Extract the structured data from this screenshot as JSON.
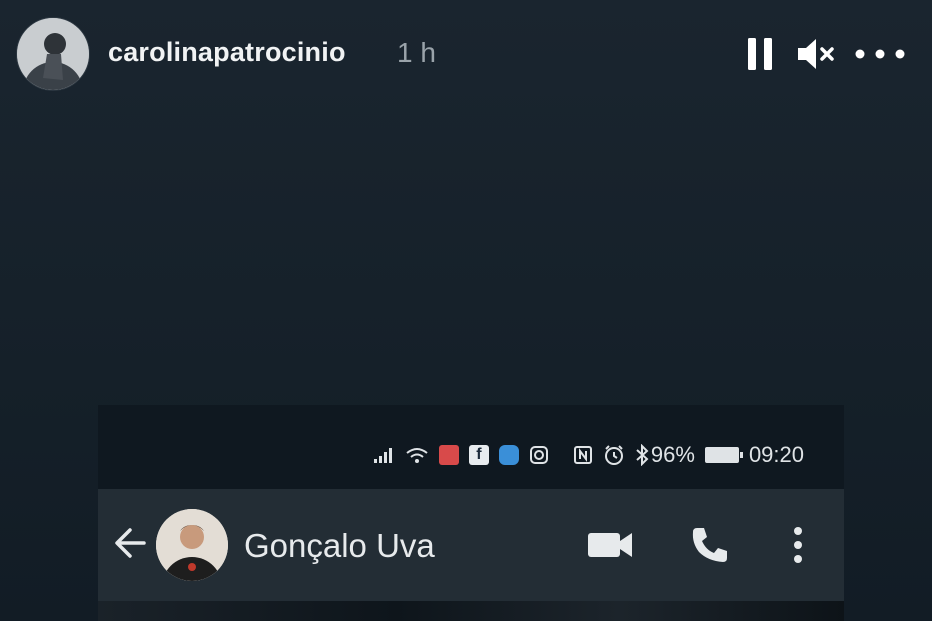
{
  "story": {
    "username": "carolinapatrocinio",
    "time_ago": "1 h",
    "controls": {
      "pause_icon": "pause-icon",
      "mute_icon": "speaker-muted-icon",
      "more_icon": "more-horizontal-icon"
    }
  },
  "phone": {
    "status_bar": {
      "battery_percent": "96%",
      "time": "09:20",
      "icons": [
        "signal-icon",
        "wifi-icon",
        "mail-app-icon",
        "facebook-icon",
        "messenger-icon",
        "instagram-icon",
        "nfc-icon",
        "alarm-icon",
        "bluetooth-icon",
        "battery-icon"
      ]
    },
    "chat_header": {
      "contact_name": "Gonçalo Uva",
      "back_icon": "arrow-back-icon",
      "video_icon": "video-call-icon",
      "call_icon": "phone-call-icon",
      "menu_icon": "more-vertical-icon"
    }
  },
  "colors": {
    "background": "#14202a",
    "chat_header": "#232d35",
    "status_bar": "#0f1820",
    "text_primary": "#f1f3f4",
    "text_secondary": "#9aa3aa"
  }
}
